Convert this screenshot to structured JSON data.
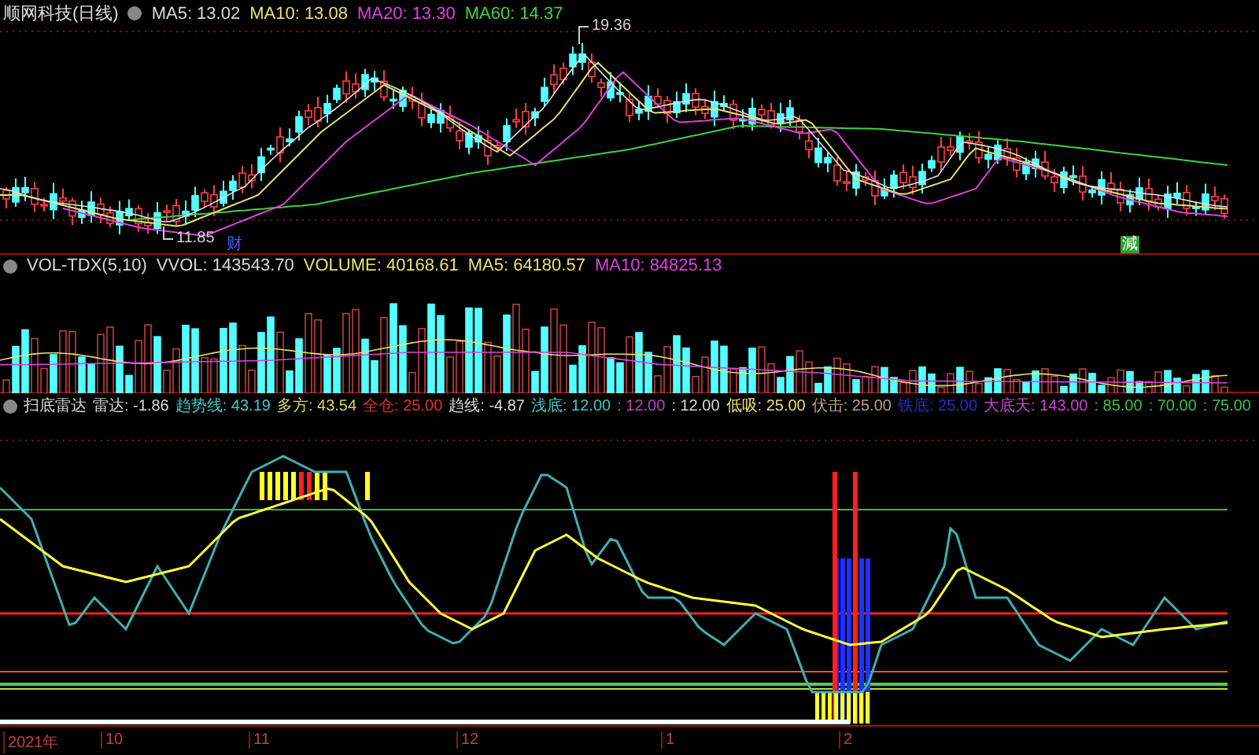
{
  "price_panel": {
    "title": "顺网科技(日线)",
    "indicators": [
      {
        "label": "MA5: 13.02",
        "color": "#d8d8d8"
      },
      {
        "label": "MA10: 13.08",
        "color": "#e8e070"
      },
      {
        "label": "MA20: 13.30",
        "color": "#e040e0"
      },
      {
        "label": "MA60: 14.37",
        "color": "#40d040"
      }
    ],
    "high_label": "19.36",
    "low_label": "11.85",
    "markers": [
      {
        "text": "财",
        "color": "#4060ff"
      },
      {
        "text": "減",
        "color": "#30a030"
      }
    ]
  },
  "volume_panel": {
    "indicators": [
      {
        "label": "VOL-TDX(5,10)",
        "color": "#d8d8d8"
      },
      {
        "label": "VVOL: 143543.70",
        "color": "#d8d8d8"
      },
      {
        "label": "VOLUME: 40168.61",
        "color": "#e8e070"
      },
      {
        "label": "MA5: 64180.57",
        "color": "#e8e070"
      },
      {
        "label": "MA10: 84825.13",
        "color": "#e040e0"
      }
    ]
  },
  "radar_panel": {
    "indicators": [
      {
        "label": "扫底雷达",
        "color": "#d8d8d8"
      },
      {
        "label": "雷达: -1.86",
        "color": "#d8d8d8"
      },
      {
        "label": "趋势线: 43.19",
        "color": "#40c8c8"
      },
      {
        "label": "多方: 43.54",
        "color": "#d8d060"
      },
      {
        "label": "全仓: 25.00",
        "color": "#e03030"
      },
      {
        "label": "趋线: -4.87",
        "color": "#d8d8d8"
      },
      {
        "label": "浅底: 12.00",
        "color": "#40c8c8"
      },
      {
        "label": ": 12.00",
        "color": "#c040c0"
      },
      {
        "label": ": 12.00",
        "color": "#d8d8d8"
      },
      {
        "label": "低吸: 25.00",
        "color": "#e8e070"
      },
      {
        "label": "伏击: 25.00",
        "color": "#c0a080"
      },
      {
        "label": "铁底: 25.00",
        "color": "#2030c0"
      },
      {
        "label": "大底天: 143.00",
        "color": "#d040d0"
      },
      {
        "label": ": 85.00",
        "color": "#40c040"
      },
      {
        "label": ": 70.00",
        "color": "#40c040"
      },
      {
        "label": ": 75.00",
        "color": "#40c040"
      }
    ]
  },
  "x_axis": {
    "labels": [
      "2021年",
      "10",
      "11",
      "12",
      "1",
      "2"
    ]
  }
}
